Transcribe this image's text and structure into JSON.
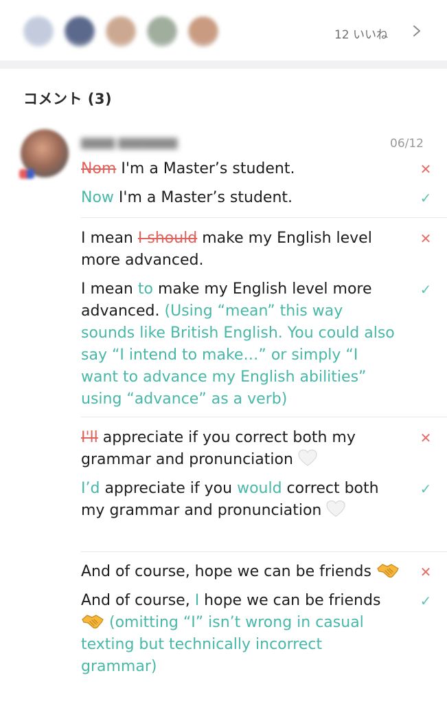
{
  "likes": {
    "count_label": "12 いいね",
    "avatar_colors": [
      "#b9c3d8",
      "#3f4f78",
      "#c49a7e",
      "#8fa08c",
      "#c08a6c"
    ]
  },
  "comments": {
    "header": "コメント (3)"
  },
  "comment": {
    "date": "06/12",
    "corrections": [
      {
        "original": [
          {
            "text": "Nom",
            "style": "strike"
          },
          {
            "text": " I'm a Master’s student.",
            "style": "normal"
          }
        ],
        "corrected": [
          {
            "text": "Now",
            "style": "teal"
          },
          {
            "text": " I'm a Master’s student.",
            "style": "normal"
          }
        ]
      },
      {
        "original": [
          {
            "text": " I mean ",
            "style": "normal"
          },
          {
            "text": "I should",
            "style": "strike"
          },
          {
            "text": " make my English level more advanced.",
            "style": "normal"
          }
        ],
        "corrected": [
          {
            "text": " I mean ",
            "style": "normal"
          },
          {
            "text": "to",
            "style": "teal"
          },
          {
            "text": " make my English level more advanced. ",
            "style": "normal"
          },
          {
            "text": "(Using “mean” this way sounds like British English. You could also say “I intend to make…” or simply “I want to advance my English abilities” using “advance” as a verb)",
            "style": "teal"
          }
        ]
      },
      {
        "original": [
          {
            "text": "I'll",
            "style": "strike"
          },
          {
            "text": " appreciate if you correct both my grammar and pronunciation ",
            "style": "normal"
          },
          {
            "text": "white-heart-emoji",
            "style": "emoji-heart"
          }
        ],
        "corrected": [
          {
            "text": "I’d",
            "style": "teal"
          },
          {
            "text": " appreciate if you ",
            "style": "normal"
          },
          {
            "text": "would",
            "style": "teal"
          },
          {
            "text": " correct both my grammar and pronunciation ",
            "style": "normal"
          },
          {
            "text": "white-heart-emoji",
            "style": "emoji-heart"
          }
        ]
      },
      {
        "original": [
          {
            "text": "And of course, hope we can be friends ",
            "style": "normal"
          },
          {
            "text": "handshake-emoji",
            "style": "emoji-shake"
          }
        ],
        "corrected": [
          {
            "text": "And of course, ",
            "style": "normal"
          },
          {
            "text": "I",
            "style": "teal"
          },
          {
            "text": " hope we can be friends ",
            "style": "normal"
          },
          {
            "text": "handshake-emoji",
            "style": "emoji-shake"
          },
          {
            "text": " (omitting “I” isn’t wrong in casual texting but technically incorrect grammar)",
            "style": "teal"
          }
        ]
      }
    ]
  },
  "colors": {
    "incorrect": "#e0625c",
    "correct": "#47b7a8"
  }
}
